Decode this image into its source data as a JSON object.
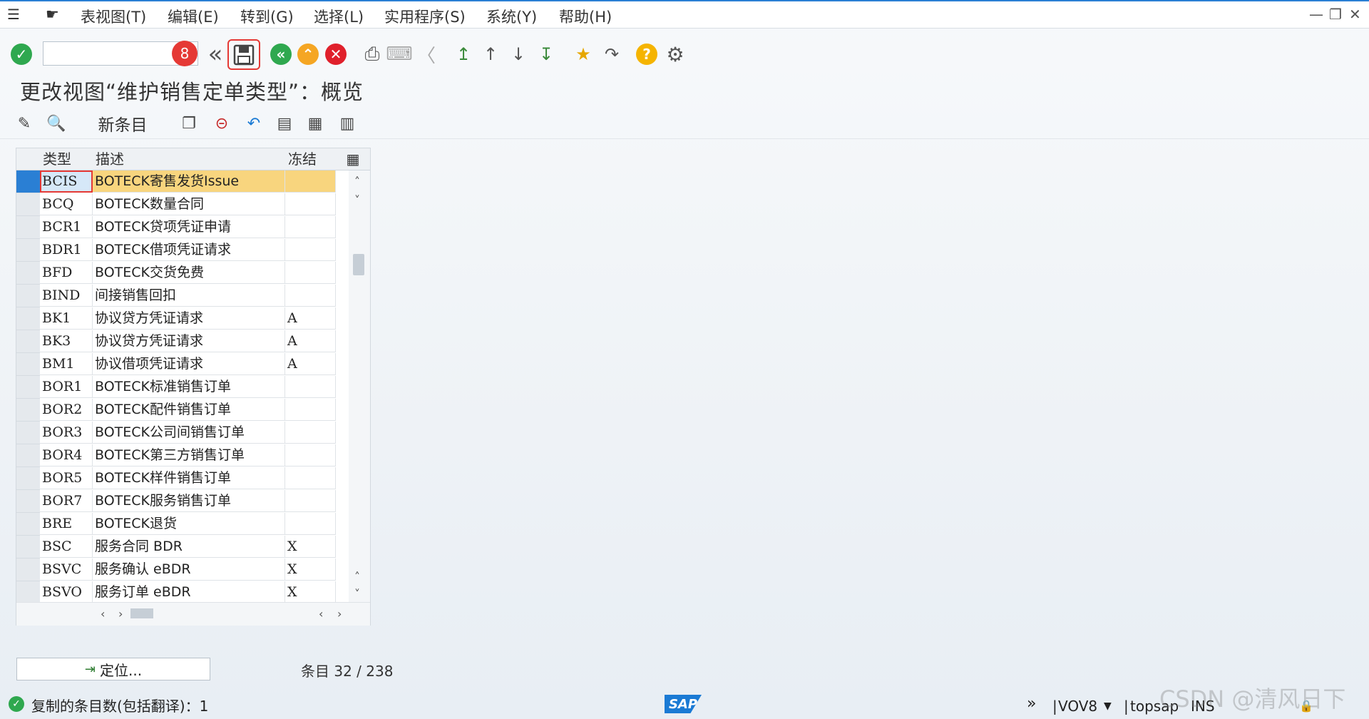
{
  "menu": [
    "表视图(T)",
    "编辑(E)",
    "转到(G)",
    "选择(L)",
    "实用程序(S)",
    "系统(Y)",
    "帮助(H)"
  ],
  "toolbar": {
    "command_value": "",
    "badge": "8"
  },
  "title": "更改视图“维护销售定单类型”：概览",
  "subtoolbar": {
    "new_entries": "新条目"
  },
  "table": {
    "headers": [
      "类型",
      "描述",
      "冻结"
    ],
    "rows": [
      {
        "type": "BCIS",
        "desc": "BOTECK寄售发货Issue",
        "freeze": ""
      },
      {
        "type": "BCQ",
        "desc": "BOTECK数量合同",
        "freeze": ""
      },
      {
        "type": "BCR1",
        "desc": "BOTECK贷项凭证申请",
        "freeze": ""
      },
      {
        "type": "BDR1",
        "desc": "BOTECK借项凭证请求",
        "freeze": ""
      },
      {
        "type": "BFD",
        "desc": "BOTECK交货免费",
        "freeze": ""
      },
      {
        "type": "BIND",
        "desc": "间接销售回扣",
        "freeze": ""
      },
      {
        "type": "BK1",
        "desc": "协议贷方凭证请求",
        "freeze": "A"
      },
      {
        "type": "BK3",
        "desc": "协议贷方凭证请求",
        "freeze": "A"
      },
      {
        "type": "BM1",
        "desc": "协议借项凭证请求",
        "freeze": "A"
      },
      {
        "type": "BOR1",
        "desc": "BOTECK标准销售订单",
        "freeze": ""
      },
      {
        "type": "BOR2",
        "desc": "BOTECK配件销售订单",
        "freeze": ""
      },
      {
        "type": "BOR3",
        "desc": "BOTECK公司间销售订单",
        "freeze": ""
      },
      {
        "type": "BOR4",
        "desc": "BOTECK第三方销售订单",
        "freeze": ""
      },
      {
        "type": "BOR5",
        "desc": "BOTECK样件销售订单",
        "freeze": ""
      },
      {
        "type": "BOR7",
        "desc": "BOTECK服务销售订单",
        "freeze": ""
      },
      {
        "type": "BRE",
        "desc": "BOTECK退货",
        "freeze": ""
      },
      {
        "type": "BSC",
        "desc": "服务合同 BDR",
        "freeze": "X"
      },
      {
        "type": "BSVC",
        "desc": "服务确认 eBDR",
        "freeze": "X"
      },
      {
        "type": "BSVO",
        "desc": "服务订单 eBDR",
        "freeze": "X"
      }
    ]
  },
  "position_button": "定位...",
  "entries_label": "条目 32 / 238",
  "status": {
    "message": "复制的条目数(包括翻译)：1",
    "logo": "SAP",
    "tcode": "VOV8",
    "system": "topsap",
    "mode": "INS",
    "watermark": "CSDN @清风日下"
  },
  "colors": {
    "accent": "#2a7fd4",
    "selected_row": "#f8d57e",
    "selected_cell": "#d6e8f8",
    "badge": "#e53935"
  }
}
